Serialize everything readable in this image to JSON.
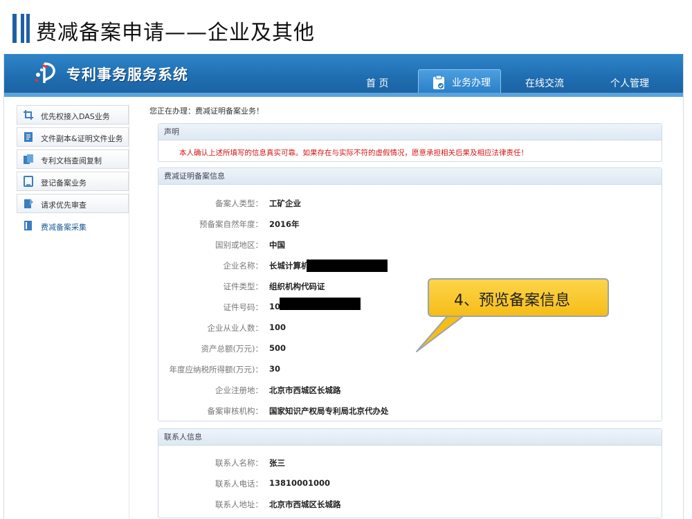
{
  "slide": {
    "title": "费减备案申请——企业及其他"
  },
  "app": {
    "title": "专利事务服务系统"
  },
  "nav": {
    "home": "首 页",
    "business": "业务办理",
    "online": "在线交流",
    "personal": "个人管理"
  },
  "sidebar": {
    "items": [
      {
        "label": "优先权接入DAS业务",
        "icon": "crop-icon"
      },
      {
        "label": "文件副本&证明文件业务",
        "icon": "document-icon"
      },
      {
        "label": "专利文档查阅复制",
        "icon": "copy-icon"
      },
      {
        "label": "登记备案业务",
        "icon": "register-icon"
      },
      {
        "label": "请求优先审查",
        "icon": "priority-icon"
      },
      {
        "label": "费减备案采集",
        "icon": "book-icon"
      }
    ]
  },
  "status_line": "您正在办理：费减证明备案业务！",
  "declaration": {
    "header": "声明",
    "text": "本人确认上述所填写的信息真实可靠。如果存在与实际不符的虚假情况，愿意承担相关后果及相应法律责任！"
  },
  "filing_info": {
    "header": "费减证明备案信息",
    "rows": [
      {
        "label": "备案人类型：",
        "value": "工矿企业"
      },
      {
        "label": "预备案自然年度：",
        "value": "2016年"
      },
      {
        "label": "国别或地区：",
        "value": "中国"
      },
      {
        "label": "企业名称：",
        "value": "长城计算机"
      },
      {
        "label": "证件类型：",
        "value": "组织机构代码证"
      },
      {
        "label": "证件号码：",
        "value": "10"
      },
      {
        "label": "企业从业人数：",
        "value": "100"
      },
      {
        "label": "资产总额(万元)：",
        "value": "500"
      },
      {
        "label": "年度应纳税所得额(万元)：",
        "value": "30"
      },
      {
        "label": "企业注册地：",
        "value": "北京市西城区长城路"
      },
      {
        "label": "备案审核机构：",
        "value": "国家知识产权局专利局北京代办处"
      }
    ]
  },
  "contact_info": {
    "header": "联系人信息",
    "rows": [
      {
        "label": "联系人名称：",
        "value": "张三"
      },
      {
        "label": "联系人电话：",
        "value": "13810001000"
      },
      {
        "label": "联系人地址：",
        "value": "北京市西城区长城路"
      }
    ]
  },
  "callout": {
    "text": "4、预览备案信息"
  },
  "colors": {
    "header_blue": "#1f6db1",
    "warning_red": "#d61414",
    "callout_yellow": "#f6bd18"
  }
}
